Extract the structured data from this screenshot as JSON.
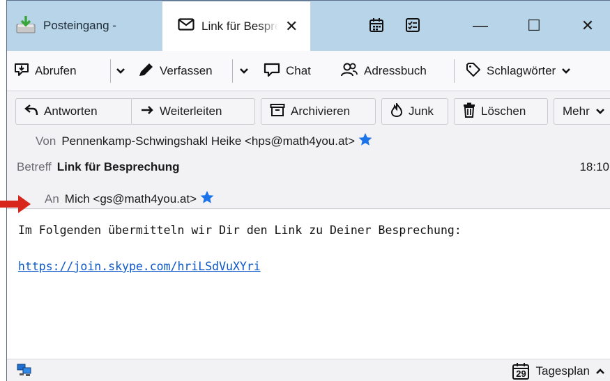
{
  "window": {
    "tabs": [
      {
        "label": "Posteingang -",
        "active": false,
        "icon": "inbox-download-icon"
      },
      {
        "label": "Link für Besprechung",
        "active": true,
        "icon": "envelope-icon",
        "close": "✕"
      }
    ],
    "toolbar_icons": [
      "calendar-icon",
      "tasks-icon"
    ],
    "controls": {
      "minimize": "—",
      "maximize": "☐",
      "close": "✕"
    }
  },
  "toolbar": {
    "get_mail": "Abrufen",
    "compose": "Verfassen",
    "chat": "Chat",
    "address_book": "Adressbuch",
    "tags": "Schlagwörter"
  },
  "message_actions": {
    "reply": "Antworten",
    "forward": "Weiterleiten",
    "archive": "Archivieren",
    "junk": "Junk",
    "delete": "Löschen",
    "more": "Mehr"
  },
  "header": {
    "from_label": "Von",
    "from_value": "Pennenkamp-Schwingshakl Heike <hps@math4you.at>",
    "subject_label": "Betreff",
    "subject_value": "Link für Besprechung",
    "time": "18:10",
    "to_label": "An",
    "to_value": "Mich <gs@math4you.at>"
  },
  "body": {
    "line1": "Im Folgenden übermitteln wir Dir den Link zu Deiner Besprechung:",
    "link": "https://join.skype.com/hriLSdVuXYri"
  },
  "statusbar": {
    "today_pane": "Tagesplan",
    "calendar_day": "29"
  },
  "colors": {
    "titlebar_bg": "#b7d4e9",
    "link": "#0b57c9",
    "star": "#1a73e8",
    "annotation": "#d9261c"
  }
}
